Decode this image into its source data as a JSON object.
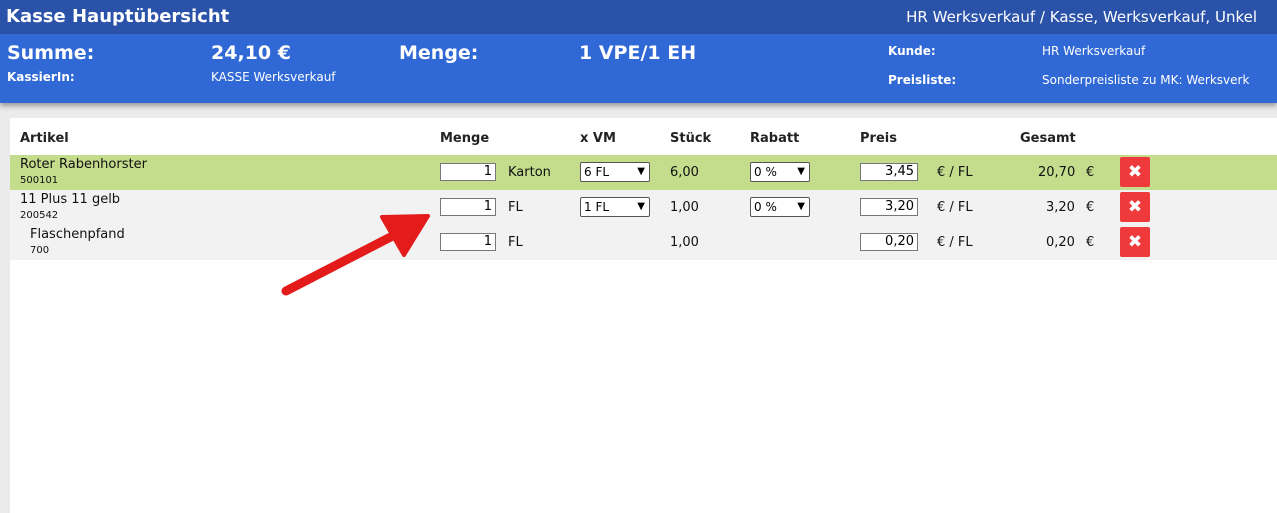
{
  "header": {
    "title": "Kasse Hauptübersicht",
    "context": "HR Werksverkauf / Kasse, Werksverkauf, Unkel"
  },
  "summary": {
    "summe_label": "Summe:",
    "summe_value": "24,10 €",
    "menge_label": "Menge:",
    "menge_value": "1 VPE/1 EH",
    "kassierin_label": "KassierIn:",
    "kassierin_value": "KASSE Werksverkauf",
    "kunde_label": "Kunde:",
    "kunde_value": "HR Werksverkauf",
    "preisliste_label": "Preisliste:",
    "preisliste_value": "Sonderpreisliste zu MK: Werksverk"
  },
  "table": {
    "headers": {
      "artikel": "Artikel",
      "menge": "Menge",
      "xvm": "x VM",
      "stueck": "Stück",
      "rabatt": "Rabatt",
      "preis": "Preis",
      "gesamt": "Gesamt"
    },
    "rows": [
      {
        "name": "Roter Rabenhorster",
        "number": "500101",
        "qty": "1",
        "unit": "Karton",
        "vm": "6 FL",
        "stueck": "6,00",
        "rabatt": "0 %",
        "preis": "3,45",
        "preis_unit": "€ / FL",
        "gesamt": "20,70",
        "currency": "€",
        "delete": "✖"
      },
      {
        "name": "11 Plus 11 gelb",
        "number": "200542",
        "qty": "1",
        "unit": "FL",
        "vm": "1 FL",
        "stueck": "1,00",
        "rabatt": "0 %",
        "preis": "3,20",
        "preis_unit": "€ / FL",
        "gesamt": "3,20",
        "currency": "€",
        "delete": "✖"
      },
      {
        "name": "Flaschenpfand",
        "number": "700",
        "qty": "1",
        "unit": "FL",
        "stueck": "1,00",
        "preis": "0,20",
        "preis_unit": "€ / FL",
        "gesamt": "0,20",
        "currency": "€",
        "delete": "✖"
      }
    ]
  },
  "colors": {
    "titlebar": "#2a52a8",
    "summary_bar": "#3068d6",
    "highlight_row": "#c4dd8c",
    "alt_row": "#f2f2f2",
    "delete_button": "#ee3a3a",
    "annotation_arrow": "#e31b1b"
  },
  "icons": {
    "delete": "close-x-icon",
    "select_arrow": "chevron-down-icon",
    "annotation": "red-arrow-annotation"
  }
}
